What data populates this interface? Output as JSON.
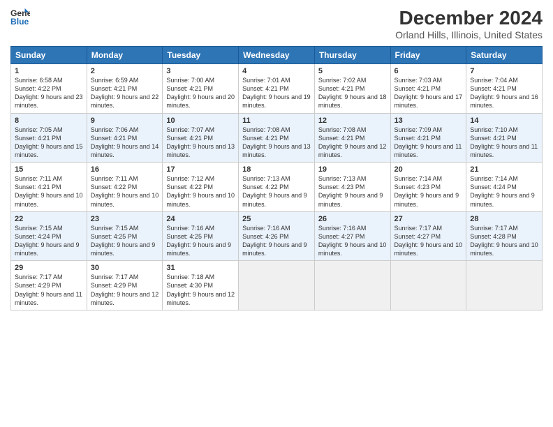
{
  "header": {
    "logo_line1": "General",
    "logo_line2": "Blue",
    "title": "December 2024",
    "subtitle": "Orland Hills, Illinois, United States"
  },
  "weekdays": [
    "Sunday",
    "Monday",
    "Tuesday",
    "Wednesday",
    "Thursday",
    "Friday",
    "Saturday"
  ],
  "weeks": [
    [
      {
        "day": "1",
        "sunrise": "Sunrise: 6:58 AM",
        "sunset": "Sunset: 4:22 PM",
        "daylight": "Daylight: 9 hours and 23 minutes."
      },
      {
        "day": "2",
        "sunrise": "Sunrise: 6:59 AM",
        "sunset": "Sunset: 4:21 PM",
        "daylight": "Daylight: 9 hours and 22 minutes."
      },
      {
        "day": "3",
        "sunrise": "Sunrise: 7:00 AM",
        "sunset": "Sunset: 4:21 PM",
        "daylight": "Daylight: 9 hours and 20 minutes."
      },
      {
        "day": "4",
        "sunrise": "Sunrise: 7:01 AM",
        "sunset": "Sunset: 4:21 PM",
        "daylight": "Daylight: 9 hours and 19 minutes."
      },
      {
        "day": "5",
        "sunrise": "Sunrise: 7:02 AM",
        "sunset": "Sunset: 4:21 PM",
        "daylight": "Daylight: 9 hours and 18 minutes."
      },
      {
        "day": "6",
        "sunrise": "Sunrise: 7:03 AM",
        "sunset": "Sunset: 4:21 PM",
        "daylight": "Daylight: 9 hours and 17 minutes."
      },
      {
        "day": "7",
        "sunrise": "Sunrise: 7:04 AM",
        "sunset": "Sunset: 4:21 PM",
        "daylight": "Daylight: 9 hours and 16 minutes."
      }
    ],
    [
      {
        "day": "8",
        "sunrise": "Sunrise: 7:05 AM",
        "sunset": "Sunset: 4:21 PM",
        "daylight": "Daylight: 9 hours and 15 minutes."
      },
      {
        "day": "9",
        "sunrise": "Sunrise: 7:06 AM",
        "sunset": "Sunset: 4:21 PM",
        "daylight": "Daylight: 9 hours and 14 minutes."
      },
      {
        "day": "10",
        "sunrise": "Sunrise: 7:07 AM",
        "sunset": "Sunset: 4:21 PM",
        "daylight": "Daylight: 9 hours and 13 minutes."
      },
      {
        "day": "11",
        "sunrise": "Sunrise: 7:08 AM",
        "sunset": "Sunset: 4:21 PM",
        "daylight": "Daylight: 9 hours and 13 minutes."
      },
      {
        "day": "12",
        "sunrise": "Sunrise: 7:08 AM",
        "sunset": "Sunset: 4:21 PM",
        "daylight": "Daylight: 9 hours and 12 minutes."
      },
      {
        "day": "13",
        "sunrise": "Sunrise: 7:09 AM",
        "sunset": "Sunset: 4:21 PM",
        "daylight": "Daylight: 9 hours and 11 minutes."
      },
      {
        "day": "14",
        "sunrise": "Sunrise: 7:10 AM",
        "sunset": "Sunset: 4:21 PM",
        "daylight": "Daylight: 9 hours and 11 minutes."
      }
    ],
    [
      {
        "day": "15",
        "sunrise": "Sunrise: 7:11 AM",
        "sunset": "Sunset: 4:21 PM",
        "daylight": "Daylight: 9 hours and 10 minutes."
      },
      {
        "day": "16",
        "sunrise": "Sunrise: 7:11 AM",
        "sunset": "Sunset: 4:22 PM",
        "daylight": "Daylight: 9 hours and 10 minutes."
      },
      {
        "day": "17",
        "sunrise": "Sunrise: 7:12 AM",
        "sunset": "Sunset: 4:22 PM",
        "daylight": "Daylight: 9 hours and 10 minutes."
      },
      {
        "day": "18",
        "sunrise": "Sunrise: 7:13 AM",
        "sunset": "Sunset: 4:22 PM",
        "daylight": "Daylight: 9 hours and 9 minutes."
      },
      {
        "day": "19",
        "sunrise": "Sunrise: 7:13 AM",
        "sunset": "Sunset: 4:23 PM",
        "daylight": "Daylight: 9 hours and 9 minutes."
      },
      {
        "day": "20",
        "sunrise": "Sunrise: 7:14 AM",
        "sunset": "Sunset: 4:23 PM",
        "daylight": "Daylight: 9 hours and 9 minutes."
      },
      {
        "day": "21",
        "sunrise": "Sunrise: 7:14 AM",
        "sunset": "Sunset: 4:24 PM",
        "daylight": "Daylight: 9 hours and 9 minutes."
      }
    ],
    [
      {
        "day": "22",
        "sunrise": "Sunrise: 7:15 AM",
        "sunset": "Sunset: 4:24 PM",
        "daylight": "Daylight: 9 hours and 9 minutes."
      },
      {
        "day": "23",
        "sunrise": "Sunrise: 7:15 AM",
        "sunset": "Sunset: 4:25 PM",
        "daylight": "Daylight: 9 hours and 9 minutes."
      },
      {
        "day": "24",
        "sunrise": "Sunrise: 7:16 AM",
        "sunset": "Sunset: 4:25 PM",
        "daylight": "Daylight: 9 hours and 9 minutes."
      },
      {
        "day": "25",
        "sunrise": "Sunrise: 7:16 AM",
        "sunset": "Sunset: 4:26 PM",
        "daylight": "Daylight: 9 hours and 9 minutes."
      },
      {
        "day": "26",
        "sunrise": "Sunrise: 7:16 AM",
        "sunset": "Sunset: 4:27 PM",
        "daylight": "Daylight: 9 hours and 10 minutes."
      },
      {
        "day": "27",
        "sunrise": "Sunrise: 7:17 AM",
        "sunset": "Sunset: 4:27 PM",
        "daylight": "Daylight: 9 hours and 10 minutes."
      },
      {
        "day": "28",
        "sunrise": "Sunrise: 7:17 AM",
        "sunset": "Sunset: 4:28 PM",
        "daylight": "Daylight: 9 hours and 10 minutes."
      }
    ],
    [
      {
        "day": "29",
        "sunrise": "Sunrise: 7:17 AM",
        "sunset": "Sunset: 4:29 PM",
        "daylight": "Daylight: 9 hours and 11 minutes."
      },
      {
        "day": "30",
        "sunrise": "Sunrise: 7:17 AM",
        "sunset": "Sunset: 4:29 PM",
        "daylight": "Daylight: 9 hours and 12 minutes."
      },
      {
        "day": "31",
        "sunrise": "Sunrise: 7:18 AM",
        "sunset": "Sunset: 4:30 PM",
        "daylight": "Daylight: 9 hours and 12 minutes."
      },
      null,
      null,
      null,
      null
    ]
  ]
}
